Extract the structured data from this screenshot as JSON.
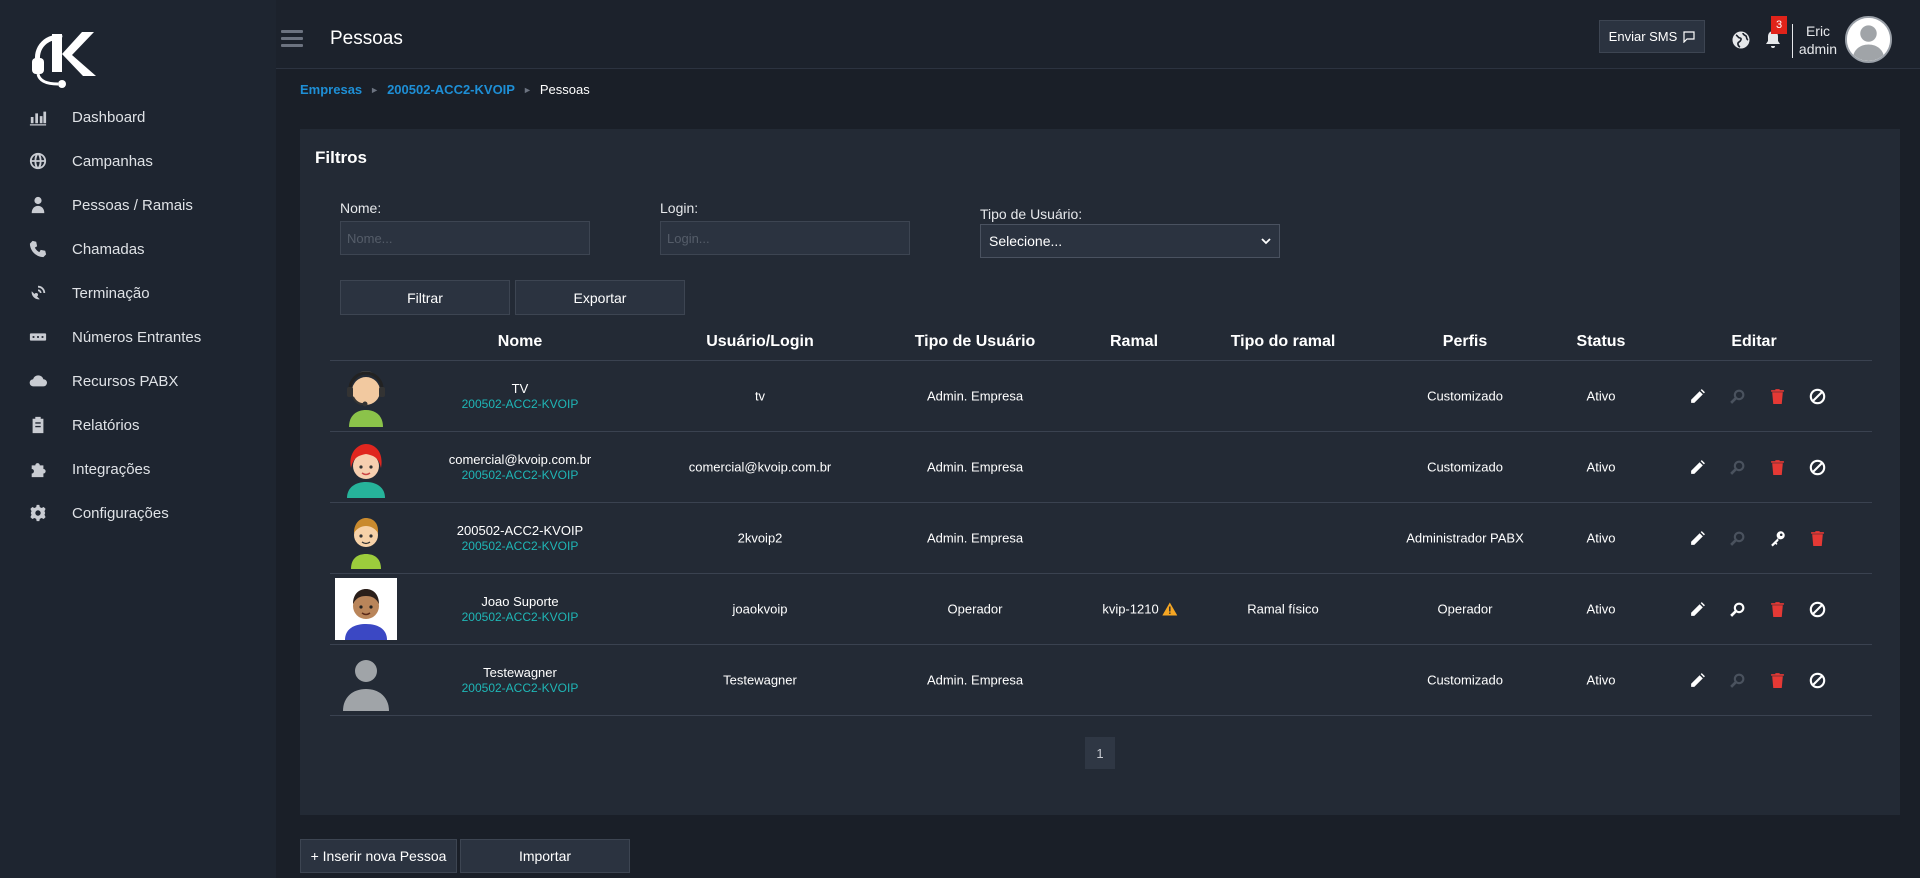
{
  "sidebar": {
    "logo": "kvoip-logo",
    "items": [
      {
        "label": "Dashboard",
        "icon": "chart-icon"
      },
      {
        "label": "Campanhas",
        "icon": "globe-icon"
      },
      {
        "label": "Pessoas / Ramais",
        "icon": "person-icon"
      },
      {
        "label": "Chamadas",
        "icon": "phone-icon"
      },
      {
        "label": "Terminação",
        "icon": "satellite-icon"
      },
      {
        "label": "Números Entrantes",
        "icon": "keypad-icon"
      },
      {
        "label": "Recursos PABX",
        "icon": "cloud-icon"
      },
      {
        "label": "Relatórios",
        "icon": "clipboard-icon"
      },
      {
        "label": "Integrações",
        "icon": "puzzle-icon"
      },
      {
        "label": "Configurações",
        "icon": "gear-icon"
      }
    ]
  },
  "topbar": {
    "title": "Pessoas",
    "sms_label": "Enviar SMS",
    "notification_count": "3",
    "user_first": "Eric",
    "user_second": "admin"
  },
  "breadcrumb": {
    "items": [
      "Empresas",
      "200502-ACC2-KVOIP"
    ],
    "current": "Pessoas"
  },
  "filters": {
    "title": "Filtros",
    "name_label": "Nome:",
    "name_placeholder": "Nome...",
    "login_label": "Login:",
    "login_placeholder": "Login...",
    "type_label": "Tipo de Usuário:",
    "type_selected": "Selecione...",
    "filter_btn": "Filtrar",
    "export_btn": "Exportar"
  },
  "table": {
    "headers": [
      "Nome",
      "Usuário/Login",
      "Tipo de Usuário",
      "Ramal",
      "Tipo do ramal",
      "Perfis",
      "Status",
      "Editar"
    ],
    "rows": [
      {
        "name": "TV",
        "company": "200502-ACC2-KVOIP",
        "login": "tv",
        "type": "Admin. Empresa",
        "ramal": "",
        "ramal_type": "",
        "profile": "Customizado",
        "status": "Ativo",
        "avatar": "headset-avatar",
        "actions": [
          "edit",
          "search-off",
          "delete",
          "block"
        ]
      },
      {
        "name": "comercial@kvoip.com.br",
        "company": "200502-ACC2-KVOIP",
        "login": "comercial@kvoip.com.br",
        "type": "Admin. Empresa",
        "ramal": "",
        "ramal_type": "",
        "profile": "Customizado",
        "status": "Ativo",
        "avatar": "redhair-avatar",
        "actions": [
          "edit",
          "search-off",
          "delete",
          "block"
        ]
      },
      {
        "name": "200502-ACC2-KVOIP",
        "company": "200502-ACC2-KVOIP",
        "login": "2kvoip2",
        "type": "Admin. Empresa",
        "ramal": "",
        "ramal_type": "",
        "profile": "Administrador PABX",
        "status": "Ativo",
        "avatar": "boy-avatar",
        "actions": [
          "edit",
          "search-off",
          "key",
          "delete"
        ]
      },
      {
        "name": "Joao Suporte",
        "company": "200502-ACC2-KVOIP",
        "login": "joaokvoip",
        "type": "Operador",
        "ramal": "kvip-1210",
        "ramal_type": "Ramal físico",
        "profile": "Operador",
        "status": "Ativo",
        "avatar": "man-avatar",
        "actions": [
          "edit",
          "search",
          "delete",
          "block"
        ]
      },
      {
        "name": "Testewagner",
        "company": "200502-ACC2-KVOIP",
        "login": "Testewagner",
        "type": "Admin. Empresa",
        "ramal": "",
        "ramal_type": "",
        "profile": "Customizado",
        "status": "Ativo",
        "avatar": "silhouette-avatar",
        "actions": [
          "edit",
          "search-off",
          "delete",
          "block"
        ]
      }
    ]
  },
  "pagination": {
    "current": "1"
  },
  "footer": {
    "add_btn": "+ Inserir nova Pessoa",
    "import_btn": "Importar"
  },
  "colors": {
    "accent": "#1e8fd6",
    "sub_text": "#1fb6b6",
    "delete": "#e53935",
    "warning": "#f5a623",
    "badge": "#e0231a"
  }
}
